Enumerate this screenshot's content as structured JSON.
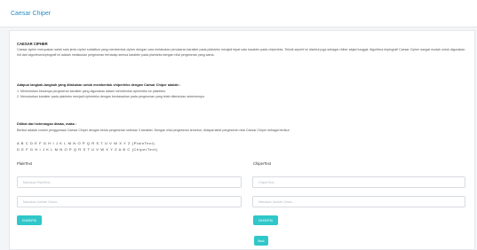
{
  "header": {
    "title": "Caesar Chiper"
  },
  "intro": {
    "heading": "CAESAR CIPHER",
    "body": "Caesar cipher merupakan salah satu jenis cipher substitusi yang membentuk cipher dengan cara melakukan penukaran karakter pada plainteks menjadi tepat satu karakter pada chiperteks. Teknik seperti ini disebut juga sebagai chiber abjad tunggal. Algoritma kriptografi Caesar Cipher sangat mudah untuk digunakan. Inti dari algoritma kriptografi ini adalah melakukan pergeseran terhadap semua karakter pada plainteks dengan nilai pergeseran yang sama."
  },
  "steps": {
    "heading": "Adapun langkah-langkah yang dilakukan untuk membentuk chiperteks dengan Caesar Chiper adalah :",
    "items": [
      "1. Menentukan besarnya pergeseran karakter yang digunakan dalam membentuk cipherteks ke plainteks.",
      "2. Menukarkan karakter pada plainteks menjadi cipherteks dengan berdasarkan pada pergeseran yang telah ditentukan sebelumnya."
    ]
  },
  "example": {
    "heading": "Dilihat dari keterangan diatas, maka :",
    "body": "Berikut adalah contoh penggunaan Caesar Chiper dengan besar pergeseran sebesar 3 karakter. Dengan nilai pergeseran tersebut, didapat tabel pergeseran nilai Caesar Chiper sebagai berikut :",
    "plain_row": "A B C D E F G H I J K L M N O P Q R S T U V W X Y Z (PlainText)",
    "cipher_row": "D E F G H I J K L M N O P Q R S T U V W X Y Z A B C (ChiperText)"
  },
  "plaintext": {
    "label": "PlainText",
    "input_placeholder": "Masukan PlainText...",
    "shift_placeholder": "Masukan Jumlah Geser...",
    "button_label": "ENKRIPSI"
  },
  "ciphertext": {
    "label": "ChiperText",
    "input_placeholder": "ChiperText...",
    "shift_placeholder": "Masukan Jumlah Geser...",
    "button_label": "DEKRIPSI"
  },
  "back_button": {
    "label": "Back"
  },
  "colors": {
    "accent": "#2fc7c9",
    "title": "#2a8fbd"
  }
}
